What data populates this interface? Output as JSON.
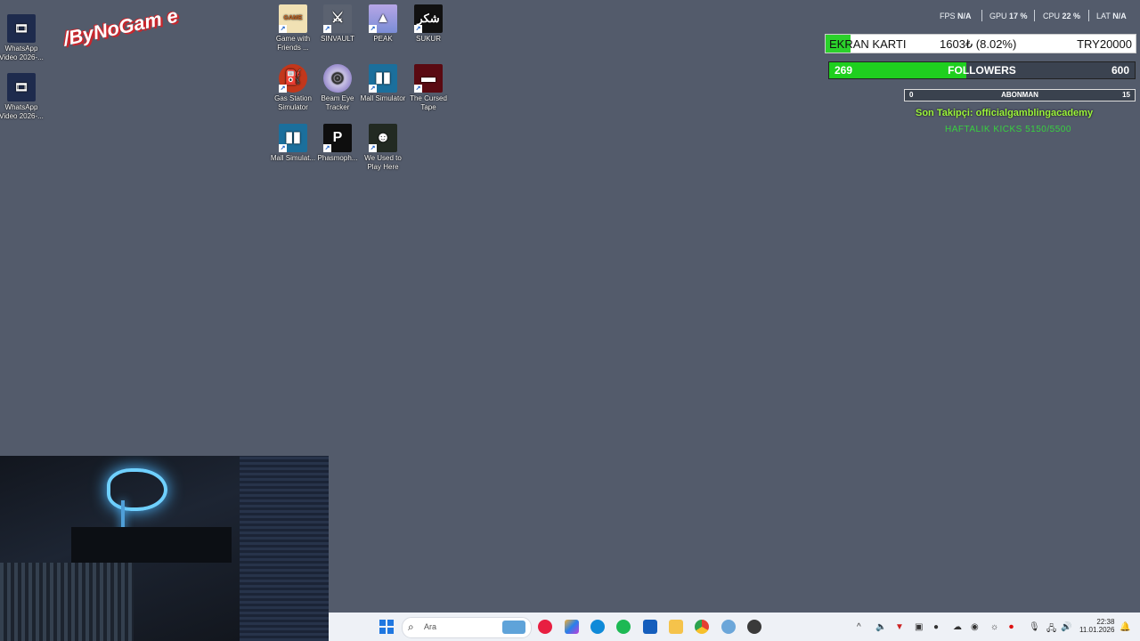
{
  "logo": {
    "text": "/ByNoGam e"
  },
  "desktop_icons": [
    {
      "label": "WhatsApp Video 2026-...",
      "name": "whatsapp-video-1-icon"
    },
    {
      "label": "WhatsApp Video 2026-...",
      "name": "whatsapp-video-2-icon"
    },
    {
      "label": "Game with Friends ...",
      "name": "game-with-friends-icon"
    },
    {
      "label": "SINVAULT",
      "name": "sinvault-icon"
    },
    {
      "label": "PEAK",
      "name": "peak-icon"
    },
    {
      "label": "SUKUR",
      "name": "sukur-icon",
      "glyph": "شكر"
    },
    {
      "label": "Gas Station Simulator",
      "name": "gas-station-simulator-icon"
    },
    {
      "label": "Beam Eye Tracker",
      "name": "beam-eye-tracker-icon"
    },
    {
      "label": "Mall Simulator",
      "name": "mall-simulator-icon"
    },
    {
      "label": "The Cursed Tape",
      "name": "the-cursed-tape-icon"
    },
    {
      "label": "Mall Simulat...",
      "name": "mall-simulator-2-icon"
    },
    {
      "label": "Phasmoph...",
      "name": "phasmophobia-icon"
    },
    {
      "label": "We Used to Play Here",
      "name": "we-used-to-play-here-icon"
    }
  ],
  "perf_overlay": {
    "fps_label": "FPS",
    "fps_value": "N/A",
    "gpu_label": "GPU",
    "gpu_value": "17 %",
    "cpu_label": "CPU",
    "cpu_value": "22 %",
    "lat_label": "LAT",
    "lat_value": "N/A"
  },
  "gpu_goal": {
    "title": "EKRAN KARTI",
    "amount": "1603₺ (8.02%)",
    "target": "TRY20000",
    "progress": 0.0802,
    "fill_color": "#2bd12b"
  },
  "followers_goal": {
    "current": "269",
    "label": "FOLLOWERS",
    "target": "600",
    "progress": 0.448,
    "fill_color": "#1fcf1f"
  },
  "subscribers_goal": {
    "current": "0",
    "label": "ABONMAN",
    "target": "15",
    "progress": 0
  },
  "last_follower": {
    "text": "Son Takipçi: officialgamblingacademy"
  },
  "weekly_kicks": {
    "text": "HAFTALIK KICKS 5150/5500"
  },
  "taskbar": {
    "search_placeholder": "Ara",
    "time": "22:38",
    "date": "11.01.2026",
    "apps": [
      "start",
      "search",
      "widget",
      "media",
      "copilot",
      "edge",
      "spotify",
      "store",
      "explorer",
      "chrome",
      "settings",
      "obs"
    ]
  }
}
